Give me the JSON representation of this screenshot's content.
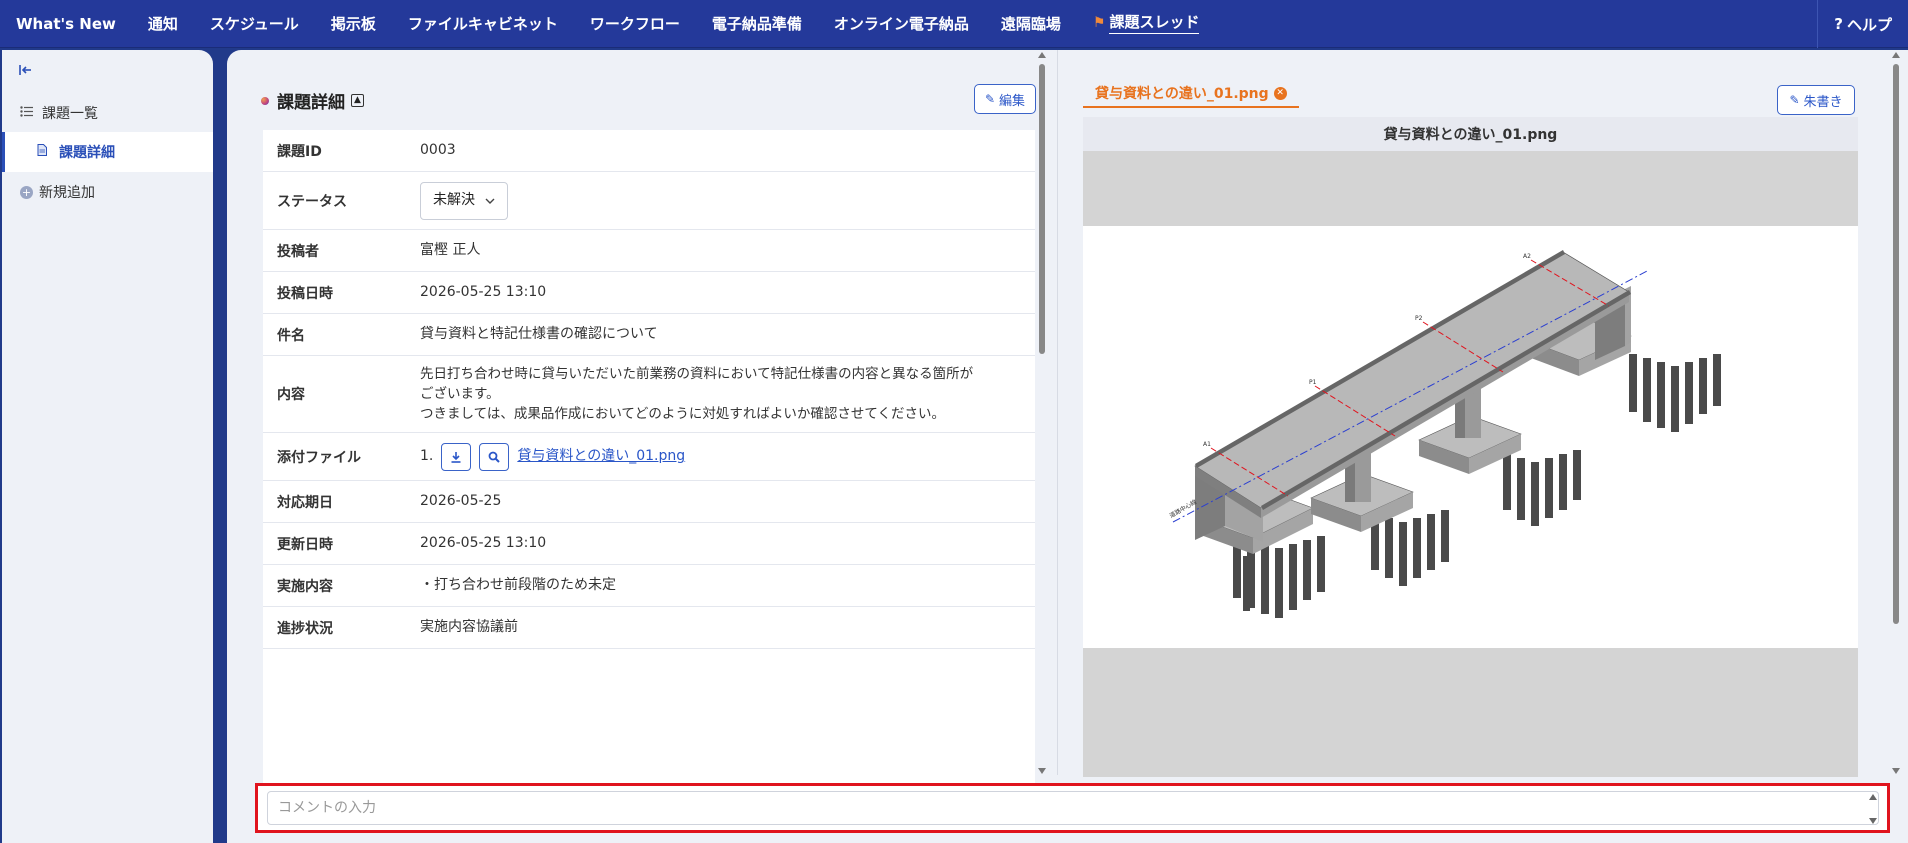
{
  "topnav": {
    "items": [
      "What's New",
      "通知",
      "スケジュール",
      "掲示板",
      "ファイルキャビネット",
      "ワークフロー",
      "電子納品準備",
      "オンライン電子納品",
      "遠隔臨場"
    ],
    "thread_label": "課題スレッド",
    "help_label": "ヘルプ",
    "help_icon": "?"
  },
  "sidebar": {
    "items": [
      {
        "label": "課題一覧",
        "icon": "list-icon"
      },
      {
        "label": "課題詳細",
        "icon": "document-icon",
        "active": true
      },
      {
        "label": "新規追加",
        "icon": "plus-circle-icon"
      }
    ]
  },
  "detail": {
    "title": "課題詳細",
    "edit_label": "編集",
    "rows": {
      "issue_id": {
        "label": "課題ID",
        "value": "0003"
      },
      "status": {
        "label": "ステータス",
        "value": "未解決"
      },
      "author": {
        "label": "投稿者",
        "value": "富樫 正人"
      },
      "posted": {
        "label": "投稿日時",
        "value": "2026-05-25 13:10"
      },
      "subject": {
        "label": "件名",
        "value": "貸与資料と特記仕様書の確認について"
      },
      "content": {
        "label": "内容",
        "line1": "先日打ち合わせ時に貸与いただいた前業務の資料において特記仕様書の内容と異なる箇所が",
        "line2": "ございます。",
        "line3": "つきましては、成果品作成においてどのように対処すればよいか確認させてください。"
      },
      "attachment": {
        "label": "添付ファイル",
        "index": "1.",
        "file": "貸与資料との違い_01.png"
      },
      "due": {
        "label": "対応期日",
        "value": "2026-05-25"
      },
      "updated": {
        "label": "更新日時",
        "value": "2026-05-25 13:10"
      },
      "action": {
        "label": "実施内容",
        "value": "・打ち合わせ前段階のため未定"
      },
      "progress": {
        "label": "進捗状況",
        "value": "実施内容協議前"
      }
    }
  },
  "preview": {
    "tab_label": "貸与資料との違い_01.png",
    "draw_label": "朱書き",
    "header": "貸与資料との違い_01.png"
  },
  "comment": {
    "placeholder": "コメントの入力"
  },
  "colors": {
    "topbar": "#24399a",
    "accent_blue": "#2a56c8",
    "accent_orange": "#e8731f",
    "highlight_red": "#e0141e"
  }
}
